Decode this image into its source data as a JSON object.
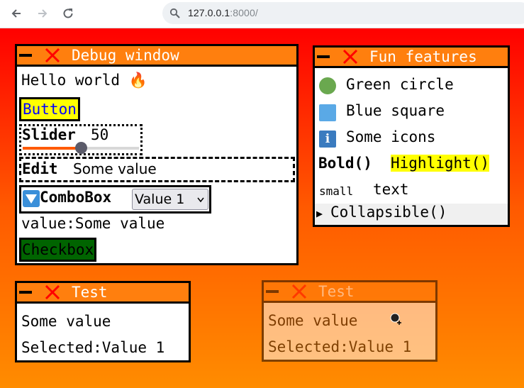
{
  "browser": {
    "url_host": "127.0.0.1",
    "url_rest": ":8000/"
  },
  "debug_window": {
    "title": "Debug window",
    "hello": "Hello world 🔥",
    "button_label": "Button",
    "slider_label": "Slider",
    "slider_value": "50",
    "slider_fraction": 0.5,
    "edit_label": "Edit",
    "edit_value": "Some value",
    "combo_label": "ComboBox",
    "combo_selected": "Value 1",
    "value_text": "value:Some value",
    "checkbox_label": "Checkbox"
  },
  "fun_window": {
    "title": "Fun features",
    "green_circle": "Green circle",
    "blue_square": "Blue square",
    "some_icons": "Some icons",
    "bold": "Bold()",
    "highlight": "Highlight()",
    "small": "small",
    "text": "text",
    "collapsible": "Collapsible()"
  },
  "test_window_1": {
    "title": "Test",
    "value": "Some value",
    "selected": "Selected:Value 1"
  },
  "test_window_2": {
    "title": "Test",
    "value": "Some value",
    "selected": "Selected:Value 1"
  },
  "colors": {
    "titlebar": "#ff7f0e",
    "gradient_top": "#ff0000",
    "gradient_bottom": "#ff8c00",
    "button_bg": "#ffff00",
    "button_text": "#0000ff",
    "checkbox_bg": "#006400",
    "slider_fill": "#ff5a00",
    "green_circle": "#6aa84f",
    "blue_square": "#5aa9e6",
    "info_icon": "#3a7bbf"
  },
  "icons": {
    "minimize": "minimize-icon",
    "close": "close-icon",
    "fire": "fire-emoji",
    "combo_arrow": "triangle-down-icon",
    "info": "info-icon",
    "cursor": "wait-cursor-icon"
  }
}
